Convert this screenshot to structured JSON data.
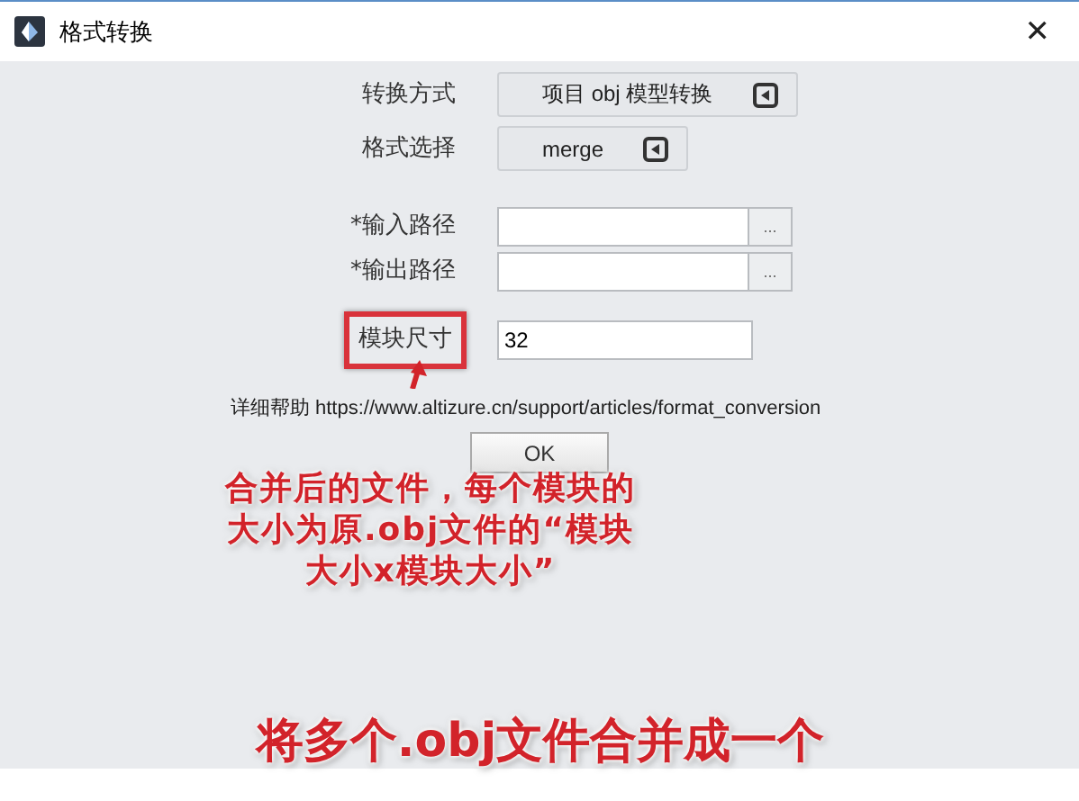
{
  "window": {
    "title": "格式转换",
    "close": "✕"
  },
  "form": {
    "rows": [
      {
        "kind": "dropdown",
        "label": "转换方式",
        "value": "项目 obj 模型转换",
        "highlighted": false
      },
      {
        "kind": "dropdown",
        "label": "格式选择",
        "value": "merge",
        "highlighted": false
      },
      {
        "kind": "path",
        "label": "*输入路径",
        "value": "",
        "browse": "...",
        "highlighted": false
      },
      {
        "kind": "path",
        "label": "*输出路径",
        "value": "",
        "browse": "...",
        "highlighted": false
      },
      {
        "kind": "number",
        "label": "模块尺寸",
        "value": "32",
        "highlighted": true
      }
    ],
    "help": {
      "label": "详细帮助",
      "link": "https://www.altizure.cn/support/articles/format_conversion"
    },
    "ok": "OK"
  },
  "annotations": {
    "callout": "合并后的文件，每个模块的大小为原.obj文件的“模块大小x模块大小”",
    "caption": "将多个.obj文件合并成一个"
  }
}
